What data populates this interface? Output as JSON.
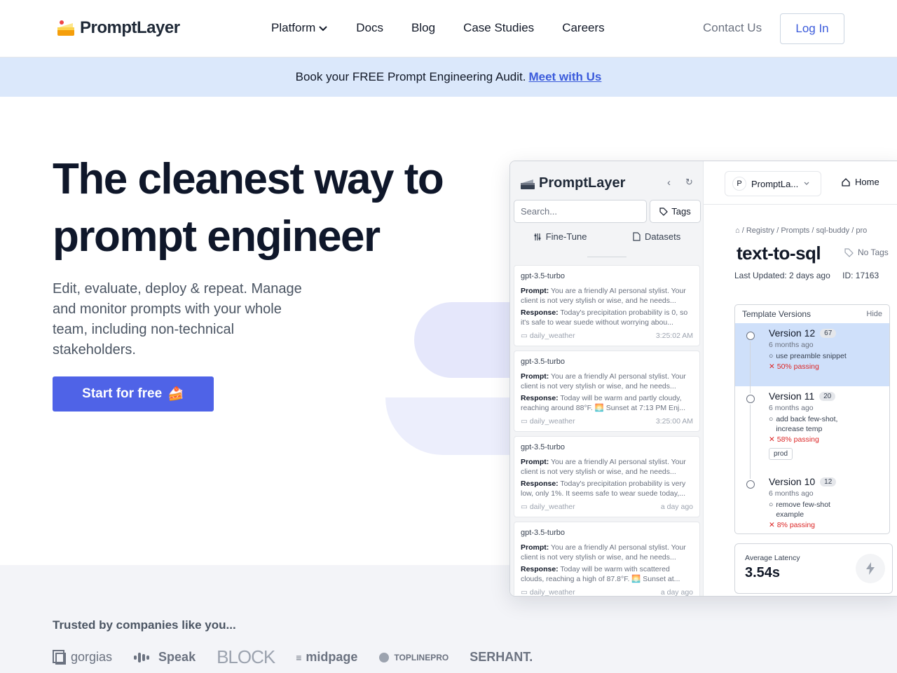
{
  "nav": {
    "brand": "PromptLayer",
    "links": [
      "Platform",
      "Docs",
      "Blog",
      "Case Studies",
      "Careers"
    ],
    "contact": "Contact Us",
    "login": "Log In"
  },
  "banner": {
    "text": "Book your FREE Prompt Engineering Audit.",
    "link": "Meet with Us"
  },
  "hero": {
    "title_line1": "The cleanest way to",
    "title_line2": "prompt engineer",
    "subtitle": "Edit, evaluate, deploy & repeat. Manage and monitor prompts with your whole team, including non-technical stakeholders.",
    "cta": "Start for free",
    "cta_emoji": "🍰"
  },
  "app": {
    "brand": "PromptLayer",
    "search_placeholder": "Search...",
    "tags_label": "Tags",
    "subtabs": [
      "Fine-Tune",
      "Datasets"
    ],
    "workspace": "PromptLa...",
    "workspace_initial": "P",
    "home": "Home",
    "requests": [
      {
        "model": "gpt-3.5-turbo",
        "prompt_label": "Prompt:",
        "prompt": "You are a friendly AI personal stylist. Your client is not very stylish or wise, and he needs...",
        "response_label": "Response:",
        "response": "Today's precipitation probability is 0, so it's safe to wear suede without worrying abou...",
        "tag": "daily_weather",
        "time": "3:25:02 AM"
      },
      {
        "model": "gpt-3.5-turbo",
        "prompt_label": "Prompt:",
        "prompt": "You are a friendly AI personal stylist. Your client is not very stylish or wise, and he needs...",
        "response_label": "Response:",
        "response": "Today will be warm and partly cloudy, reaching around 88°F. 🌅 Sunset at 7:13 PM Enj...",
        "tag": "daily_weather",
        "time": "3:25:00 AM"
      },
      {
        "model": "gpt-3.5-turbo",
        "prompt_label": "Prompt:",
        "prompt": "You are a friendly AI personal stylist. Your client is not very stylish or wise, and he needs...",
        "response_label": "Response:",
        "response": "Today's precipitation probability is very low, only 1%. It seems safe to wear suede today,...",
        "tag": "daily_weather",
        "time": "a day ago"
      },
      {
        "model": "gpt-3.5-turbo",
        "prompt_label": "Prompt:",
        "prompt": "You are a friendly AI personal stylist. Your client is not very stylish or wise, and he needs...",
        "response_label": "Response:",
        "response": "Today will be warm with scattered clouds, reaching a high of 87.8°F. 🌅 Sunset at...",
        "tag": "daily_weather",
        "time": "a day ago"
      }
    ],
    "breadcrumb": "/  Registry  /  Prompts  /  sql-buddy  /  pro",
    "prompt_title": "text-to-sql",
    "no_tags": "No Tags",
    "last_updated": "Last Updated: 2 days ago",
    "id": "ID: 17163",
    "template_versions_title": "Template Versions",
    "hide": "Hide",
    "versions": [
      {
        "name": "Version 12",
        "count": "67",
        "ago": "6 months ago",
        "msg": "use preamble snippet",
        "pass": "50% passing",
        "tag": ""
      },
      {
        "name": "Version 11",
        "count": "20",
        "ago": "6 months ago",
        "msg": "add back few-shot, increase temp",
        "pass": "58% passing",
        "tag": "prod"
      },
      {
        "name": "Version 10",
        "count": "12",
        "ago": "6 months ago",
        "msg": "remove few-shot example",
        "pass": "8% passing",
        "tag": ""
      }
    ],
    "latency_label": "Average Latency",
    "latency_value": "3.54s"
  },
  "trusted": {
    "text": "Trusted by companies like you...",
    "logos": [
      "gorgias",
      "Speak",
      "BLOCK",
      "midpage",
      "TOPLINEPRO",
      "SERHANT."
    ]
  }
}
